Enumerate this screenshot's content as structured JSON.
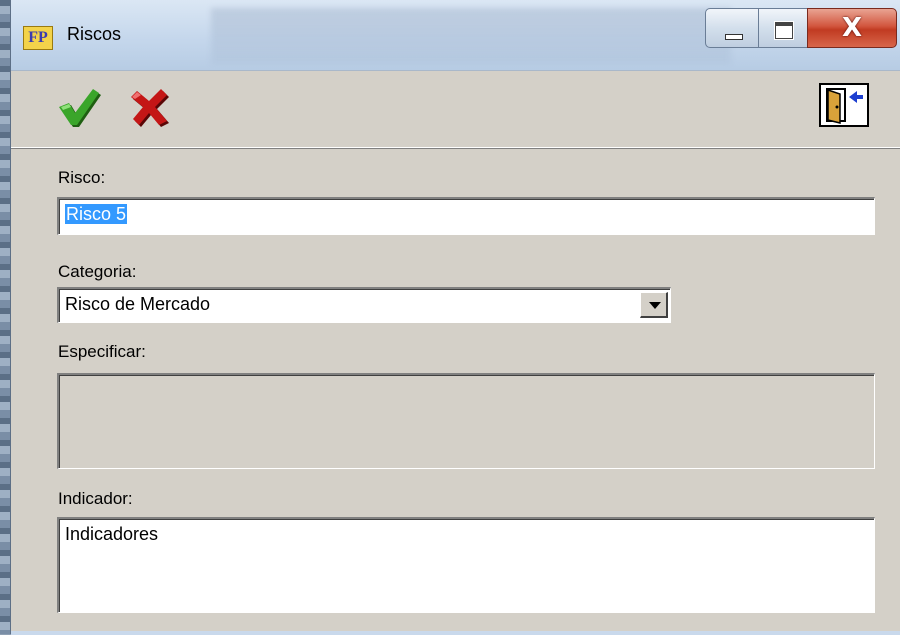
{
  "window": {
    "title": "Riscos",
    "app_icon_text": "FP",
    "buttons": {
      "minimize": "minimize-icon",
      "maximize": "maximize-icon",
      "close": "close-icon",
      "close_glyph": "X"
    }
  },
  "toolbar": {
    "confirm_icon": "checkmark-icon",
    "cancel_icon": "x-mark-icon",
    "exit_icon": "exit-door-icon",
    "confirm_color": "#2f8a1e",
    "cancel_color": "#b01010"
  },
  "form": {
    "risco": {
      "label": "Risco:",
      "value": "Risco 5"
    },
    "categoria": {
      "label": "Categoria:",
      "value": "Risco de Mercado"
    },
    "especificar": {
      "label": "Especificar:",
      "value": ""
    },
    "indicador": {
      "label": "Indicador:",
      "value": "Indicadores"
    }
  }
}
